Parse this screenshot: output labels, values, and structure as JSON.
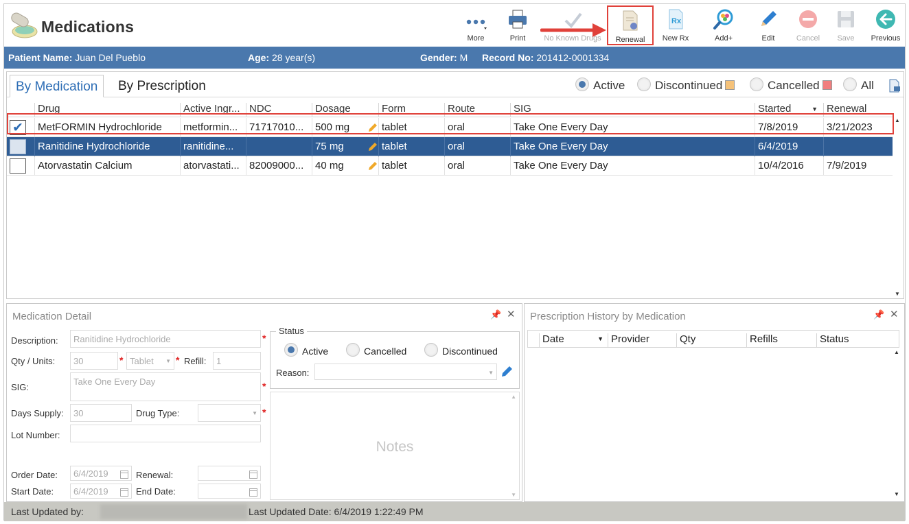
{
  "app": {
    "title": "Medications"
  },
  "toolbar": {
    "more": "More",
    "print": "Print",
    "no_known_drugs": "No Known Drugs",
    "renewal": "Renewal",
    "new_rx": "New Rx",
    "add": "Add+",
    "edit": "Edit",
    "cancel": "Cancel",
    "save": "Save",
    "previous": "Previous"
  },
  "patient": {
    "name_label": "Patient Name:",
    "name": "Juan Del Pueblo",
    "age_label": "Age:",
    "age": "28 year(s)",
    "gender_label": "Gender:",
    "gender": "M",
    "record_label": "Record No:",
    "record": "201412-0001334"
  },
  "tabs": {
    "by_medication": "By Medication",
    "by_prescription": "By Prescription"
  },
  "filters": {
    "active": "Active",
    "discontinued": "Discontinued",
    "cancelled": "Cancelled",
    "all": "All",
    "selected": "Active"
  },
  "colors": {
    "accent": "#4a78ad",
    "selected_row": "#2e5c94",
    "highlight": "#e0413a",
    "discontinued": "#f5c27a",
    "cancelled": "#f07e7e"
  },
  "grid": {
    "columns": {
      "drug": "Drug",
      "active_ingredient": "Active Ingr...",
      "ndc": "NDC",
      "dosage": "Dosage",
      "form": "Form",
      "route": "Route",
      "sig": "SIG",
      "started": "Started",
      "renewal": "Renewal"
    },
    "rows": [
      {
        "checked": true,
        "drug": "MetFORMIN Hydrochloride",
        "active_ingredient": "metformin...",
        "ndc": "71717010...",
        "dosage": "500 mg",
        "form": "tablet",
        "route": "oral",
        "sig": "Take One Every Day",
        "started": "7/8/2019",
        "renewal": "3/21/2023"
      },
      {
        "checked": false,
        "drug": "Ranitidine Hydrochloride",
        "active_ingredient": "ranitidine...",
        "ndc": "",
        "dosage": "75 mg",
        "form": "tablet",
        "route": "oral",
        "sig": "Take One Every Day",
        "started": "6/4/2019",
        "renewal": ""
      },
      {
        "checked": false,
        "drug": "Atorvastatin Calcium",
        "active_ingredient": "atorvastati...",
        "ndc": "82009000...",
        "dosage": "40 mg",
        "form": "tablet",
        "route": "oral",
        "sig": "Take One Every Day",
        "started": "10/4/2016",
        "renewal": "7/9/2019"
      }
    ]
  },
  "detail": {
    "title": "Medication Detail",
    "description_label": "Description:",
    "description": "Ranitidine Hydrochloride",
    "qty_label": "Qty / Units:",
    "qty": "30",
    "units": "Tablet",
    "refill_label": "Refill:",
    "refill": "1",
    "sig_label": "SIG:",
    "sig": "Take One Every Day",
    "days_supply_label": "Days Supply:",
    "days_supply": "30",
    "drug_type_label": "Drug Type:",
    "drug_type": "",
    "lot_number_label": "Lot Number:",
    "lot_number": "",
    "order_date_label": "Order Date:",
    "order_date": "6/4/2019",
    "renewal_label": "Renewal:",
    "renewal": "",
    "start_date_label": "Start Date:",
    "start_date": "6/4/2019",
    "end_date_label": "End Date:",
    "end_date": "",
    "status_legend": "Status",
    "status_active": "Active",
    "status_cancelled": "Cancelled",
    "status_discontinued": "Discontinued",
    "reason_label": "Reason:",
    "reason": "",
    "notes_placeholder": "Notes"
  },
  "history": {
    "title": "Prescription History by Medication",
    "columns": {
      "date": "Date",
      "provider": "Provider",
      "qty": "Qty",
      "refills": "Refills",
      "status": "Status"
    }
  },
  "footer": {
    "last_updated_by_label": "Last Updated by:",
    "last_updated_date_label": "Last Updated Date:",
    "last_updated_date": "6/4/2019 1:22:49 PM"
  }
}
